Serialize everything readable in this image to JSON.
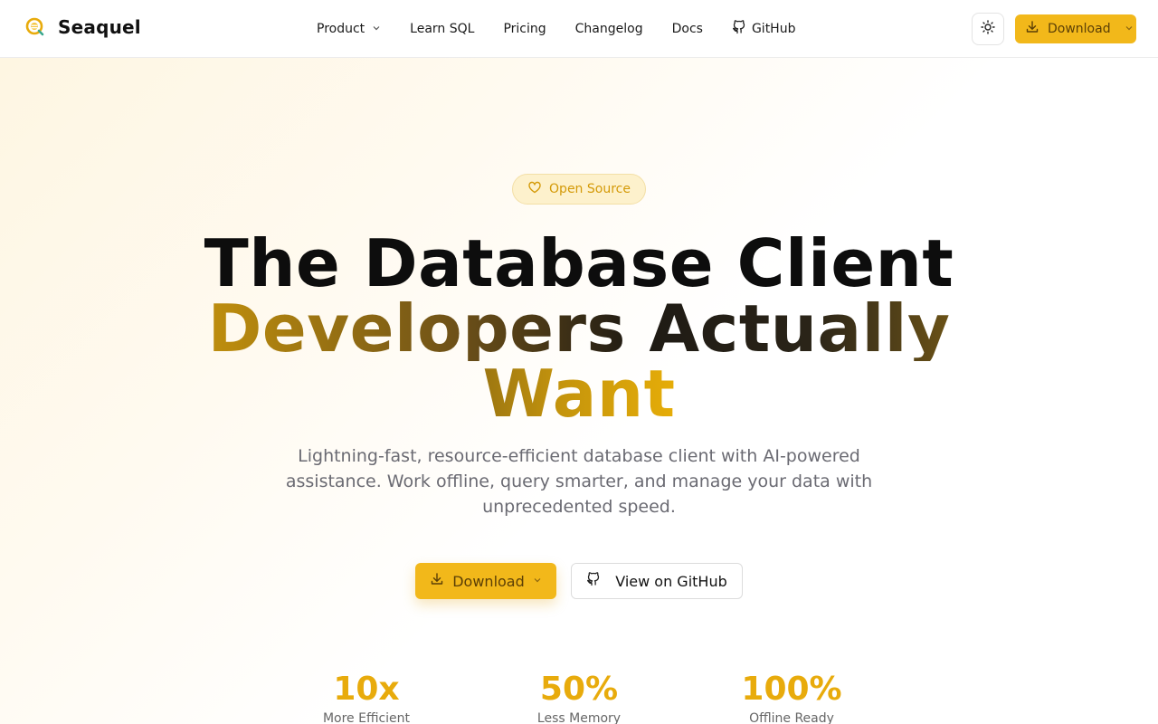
{
  "header": {
    "brand": "Seaquel",
    "nav": [
      {
        "label": "Product",
        "has_dropdown": true
      },
      {
        "label": "Learn SQL"
      },
      {
        "label": "Pricing"
      },
      {
        "label": "Changelog"
      },
      {
        "label": "Docs"
      },
      {
        "label": "GitHub",
        "icon": "github-icon"
      }
    ],
    "theme_toggle_icon": "sun-icon",
    "download_label": "Download"
  },
  "hero": {
    "badge": "Open Source",
    "headline_line1": "The Database Client",
    "headline_line2": "Developers Actually",
    "headline_line3": "Want",
    "subtext": "Lightning-fast, resource-efficient database client with AI-powered assistance. Work offline, query smarter, and manage your data with unprecedented speed.",
    "primary_cta": "Download",
    "secondary_cta": "View on GitHub"
  },
  "stats": [
    {
      "value": "10x",
      "label": "More Efficient"
    },
    {
      "value": "50%",
      "label": "Less Memory"
    },
    {
      "value": "100%",
      "label": "Offline Ready"
    }
  ],
  "colors": {
    "accent": "#f2b81a",
    "accent_text": "#e8ab0c",
    "badge_bg": "#fdf1cc"
  }
}
